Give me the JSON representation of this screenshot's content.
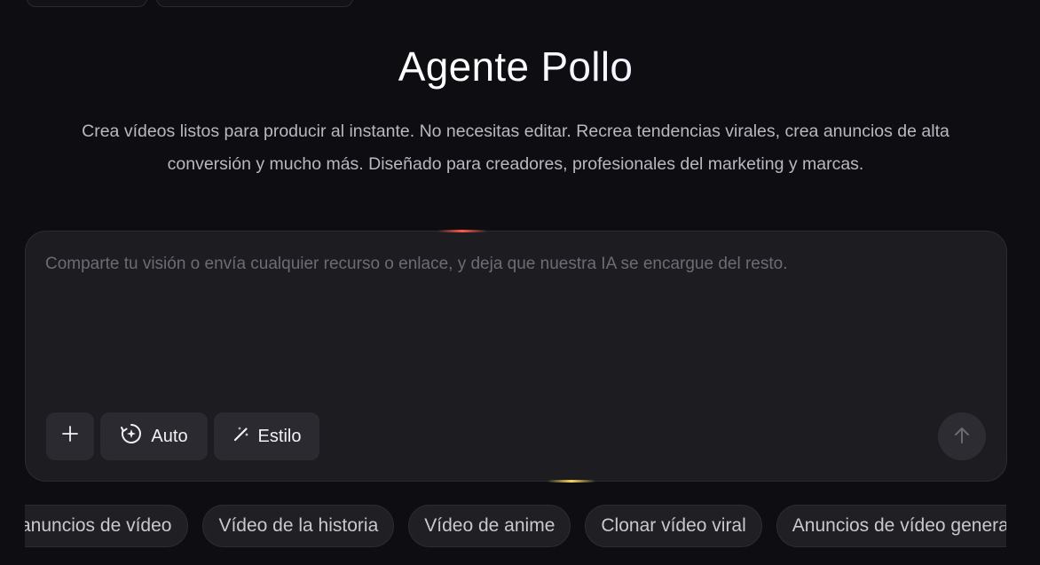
{
  "page": {
    "title": "Agente Pollo",
    "subtitle_line1": "Crea vídeos listos para producir al instante. No necesitas editar. Recrea tendencias virales, crea anuncios de alta",
    "subtitle_line2": "conversión y mucho más. Diseñado para creadores, profesionales del marketing y marcas."
  },
  "composer": {
    "input_value": "",
    "placeholder": "Comparte tu visión o envía cualquier recurso o enlace, y deja que nuestra IA se encargue del resto.",
    "add_icon": "plus-icon",
    "auto_icon": "auto-target-icon",
    "auto_label": "Auto",
    "style_icon": "magic-wand-icon",
    "style_label": "Estilo",
    "send_icon": "arrow-up-icon"
  },
  "suggestions": [
    {
      "label": "anuncios de vídeo"
    },
    {
      "label": "Vídeo de la historia"
    },
    {
      "label": "Vídeo de anime"
    },
    {
      "label": "Clonar vídeo viral"
    },
    {
      "label": "Anuncios de vídeo generativos"
    }
  ],
  "colors": {
    "background": "#0e0e12",
    "panel": "#1c1c21",
    "button": "#2a2a30",
    "text": "#ececf1",
    "muted": "#b8b8c0",
    "accent_red": "#ff5a4a",
    "accent_yellow": "#f3d35a"
  }
}
